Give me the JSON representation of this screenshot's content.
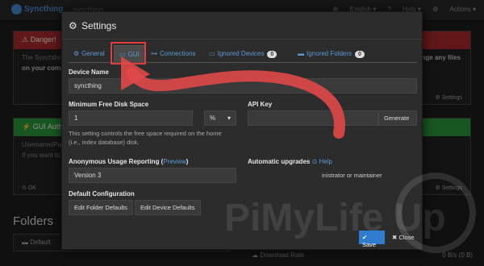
{
  "nav": {
    "brand": "Syncthing",
    "device": "syncthing",
    "language": "English",
    "help": "Help",
    "actions": "Actions"
  },
  "bg": {
    "danger_title": "Danger!",
    "danger_text_1": "The Synchthing",
    "danger_text_2": "on your comp",
    "danger_right": "nge any files",
    "danger_settings": "Settings",
    "gui_title": "GUI Authen",
    "gui_text_1": "Username/Pas",
    "gui_text_2": "If you want to",
    "gui_ok": "OK",
    "gui_settings": "Settings",
    "folders": "Folders",
    "default_folder": "Default",
    "download_rate": "Download Rate",
    "download_value": "0 B/s (0 B)"
  },
  "modal": {
    "title": "Settings",
    "tabs": [
      {
        "label": "General"
      },
      {
        "label": "GUI"
      },
      {
        "label": "Connections"
      },
      {
        "label": "Ignored Devices",
        "badge": "0"
      },
      {
        "label": "Ignored Folders",
        "badge": "0"
      }
    ],
    "device_name_label": "Device Name",
    "device_name_value": "syncthing",
    "min_disk_label": "Minimum Free Disk Space",
    "min_disk_value": "1",
    "min_disk_unit": "%",
    "min_disk_help_1": "This setting controls the free space required on the home",
    "min_disk_help_2": "(i.e., index database) disk.",
    "api_key_label": "API Key",
    "api_key_value": "",
    "generate_button": "Generate",
    "usage_label": "Anonymous Usage Reporting",
    "usage_preview": "Preview",
    "usage_value": "Version 3",
    "upgrades_label": "Automatic upgrades",
    "upgrades_help": "Help",
    "upgrades_text": "inistrator or maintainer",
    "default_config_label": "Default Configuration",
    "edit_folder_defaults": "Edit Folder Defaults",
    "edit_device_defaults": "Edit Device Defaults",
    "save_button": "Save",
    "close_button": "Close"
  },
  "watermark": {
    "text": "PiMyLife Up"
  },
  "colors": {
    "accent": "#5b9bd5",
    "danger": "#b32d2d",
    "success": "#2e9e3e",
    "highlight": "#e23c3c",
    "save": "#2e7bcf"
  }
}
